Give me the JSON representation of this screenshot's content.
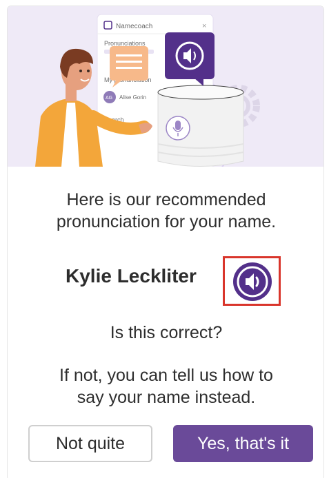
{
  "illustration": {
    "app_name": "Namecoach",
    "section_pronunciations": "Pronunciations",
    "section_my_pronunciation": "My pronunciation",
    "avatar_initials": "AG",
    "user_short": "Alise Gorin",
    "section_search": "Search"
  },
  "prompt": {
    "line1": "Here is our recommended",
    "line2": "pronunciation for your name."
  },
  "name": {
    "full_name": "Kylie Leckliter"
  },
  "question": "Is this correct?",
  "alternative": {
    "line1": "If not, you can tell us how to",
    "line2": "say your name instead."
  },
  "buttons": {
    "not_quite": "Not quite",
    "confirm": "Yes, that's it"
  },
  "colors": {
    "brand_purple": "#53308a",
    "button_purple": "#6a4a99",
    "highlight_red": "#d9352b"
  }
}
